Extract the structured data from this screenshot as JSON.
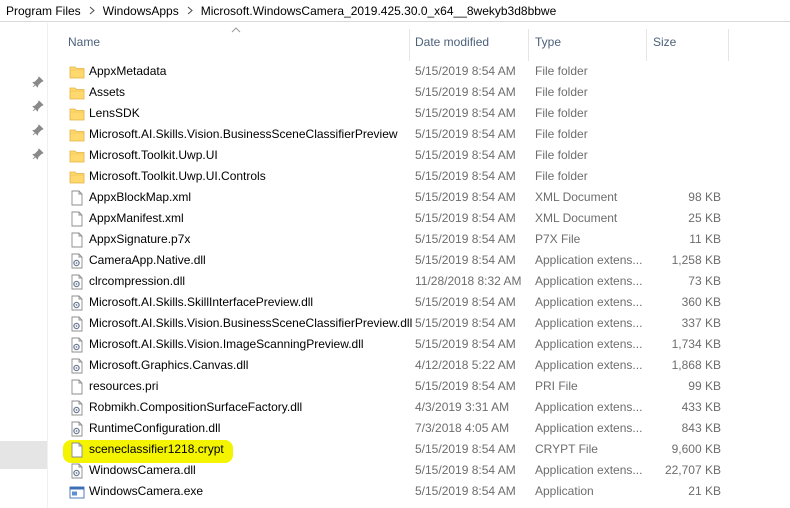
{
  "breadcrumb": {
    "items": [
      "Program Files",
      "WindowsApps",
      "Microsoft.WindowsCamera_2019.425.30.0_x64__8wekyb3d8bbwe"
    ]
  },
  "columns": {
    "name": "Name",
    "date": "Date modified",
    "type": "Type",
    "size": "Size"
  },
  "files": [
    {
      "name": "AppxMetadata",
      "date": "5/15/2019 8:54 AM",
      "type": "File folder",
      "size": "",
      "icon": "folder-icon"
    },
    {
      "name": "Assets",
      "date": "5/15/2019 8:54 AM",
      "type": "File folder",
      "size": "",
      "icon": "folder-icon"
    },
    {
      "name": "LensSDK",
      "date": "5/15/2019 8:54 AM",
      "type": "File folder",
      "size": "",
      "icon": "folder-icon"
    },
    {
      "name": "Microsoft.AI.Skills.Vision.BusinessSceneClassifierPreview",
      "date": "5/15/2019 8:54 AM",
      "type": "File folder",
      "size": "",
      "icon": "folder-icon"
    },
    {
      "name": "Microsoft.Toolkit.Uwp.UI",
      "date": "5/15/2019 8:54 AM",
      "type": "File folder",
      "size": "",
      "icon": "folder-icon"
    },
    {
      "name": "Microsoft.Toolkit.Uwp.UI.Controls",
      "date": "5/15/2019 8:54 AM",
      "type": "File folder",
      "size": "",
      "icon": "folder-icon"
    },
    {
      "name": "AppxBlockMap.xml",
      "date": "5/15/2019 8:54 AM",
      "type": "XML Document",
      "size": "98 KB",
      "icon": "file-icon"
    },
    {
      "name": "AppxManifest.xml",
      "date": "5/15/2019 8:54 AM",
      "type": "XML Document",
      "size": "25 KB",
      "icon": "file-icon"
    },
    {
      "name": "AppxSignature.p7x",
      "date": "5/15/2019 8:54 AM",
      "type": "P7X File",
      "size": "11 KB",
      "icon": "file-icon"
    },
    {
      "name": "CameraApp.Native.dll",
      "date": "5/15/2019 8:54 AM",
      "type": "Application extens...",
      "size": "1,258 KB",
      "icon": "dll-icon"
    },
    {
      "name": "clrcompression.dll",
      "date": "11/28/2018 8:32 AM",
      "type": "Application extens...",
      "size": "73 KB",
      "icon": "dll-icon"
    },
    {
      "name": "Microsoft.AI.Skills.SkillInterfacePreview.dll",
      "date": "5/15/2019 8:54 AM",
      "type": "Application extens...",
      "size": "360 KB",
      "icon": "dll-icon"
    },
    {
      "name": "Microsoft.AI.Skills.Vision.BusinessSceneClassifierPreview.dll",
      "date": "5/15/2019 8:54 AM",
      "type": "Application extens...",
      "size": "337 KB",
      "icon": "dll-icon"
    },
    {
      "name": "Microsoft.AI.Skills.Vision.ImageScanningPreview.dll",
      "date": "5/15/2019 8:54 AM",
      "type": "Application extens...",
      "size": "1,734 KB",
      "icon": "dll-icon"
    },
    {
      "name": "Microsoft.Graphics.Canvas.dll",
      "date": "4/12/2018 5:22 AM",
      "type": "Application extens...",
      "size": "1,868 KB",
      "icon": "dll-icon"
    },
    {
      "name": "resources.pri",
      "date": "5/15/2019 8:54 AM",
      "type": "PRI File",
      "size": "99 KB",
      "icon": "file-icon"
    },
    {
      "name": "Robmikh.CompositionSurfaceFactory.dll",
      "date": "4/3/2019 3:31 AM",
      "type": "Application extens...",
      "size": "433 KB",
      "icon": "dll-icon"
    },
    {
      "name": "RuntimeConfiguration.dll",
      "date": "7/3/2018 4:05 AM",
      "type": "Application extens...",
      "size": "843 KB",
      "icon": "dll-icon"
    },
    {
      "name": "sceneclassifier1218.crypt",
      "date": "5/15/2019 8:54 AM",
      "type": "CRYPT File",
      "size": "9,600 KB",
      "icon": "file-icon",
      "highlighted": true
    },
    {
      "name": "WindowsCamera.dll",
      "date": "5/15/2019 8:54 AM",
      "type": "Application extens...",
      "size": "22,707 KB",
      "icon": "dll-icon"
    },
    {
      "name": "WindowsCamera.exe",
      "date": "5/15/2019 8:54 AM",
      "type": "Application",
      "size": "21 KB",
      "icon": "exe-icon"
    }
  ],
  "colors": {
    "folder": "#ffd86e",
    "highlight": "#f4f400",
    "header_text": "#4c607a"
  }
}
